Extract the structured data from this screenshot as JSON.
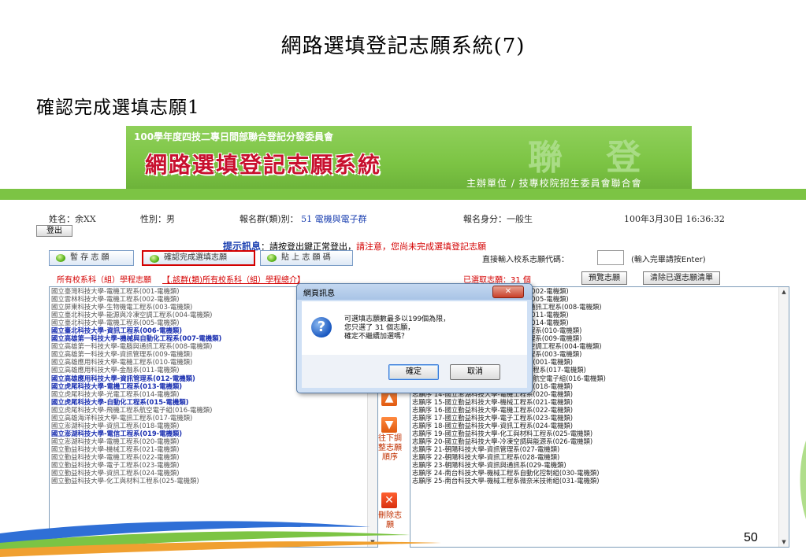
{
  "slide": {
    "title": "網路選填登記志願系統(7)",
    "subtitle": "確認完成選填志願1",
    "page_number": "50"
  },
  "banner": {
    "org": "100學年度四技二專日間部聯合登記分發委員會",
    "title": "網路選填登記志願系統",
    "host": "主辦單位 / 技專校院招生委員會聯合會",
    "watermark": "聯 登"
  },
  "user": {
    "name_label": "姓名：",
    "name_value": "余XX",
    "sex_label": "性別：",
    "sex_value": "男",
    "group_label": "報名群(類)別：",
    "group_value": "51 電機與電子群",
    "identity_label": "報名身分：",
    "identity_value": "一般生",
    "datetime": "100年3月30日 16:36:32",
    "logout_label": "登出"
  },
  "hint": {
    "label": "提示訊息",
    "text": "：請按登出鍵正常登出，",
    "warning": "請注意，您尚未完成選填登記志願"
  },
  "toolbar": {
    "save_label": "暫 存 志 願",
    "confirm_label": "確認完成選填志願",
    "paste_label": "貼 上 志 願 碼",
    "direct_label": "直接輸入校系志願代碼：",
    "direct_value": "",
    "direct_note": "(輸入完畢請按Enter)"
  },
  "list_header": {
    "all_label": "所有校系科（組）學程志願",
    "link_label": "【.該群(類)所有校系科（組）學程總介】",
    "selected_prefix": "已選取志願：",
    "selected_count": "31 個",
    "preview_label": "預覽志願",
    "clear_label": "清除已選志願清單"
  },
  "left_list": [
    {
      "text": "國立臺灣科技大學-電機工程系(001-電機類)",
      "style": ""
    },
    {
      "text": "國立雲林科技大學-電機工程系(002-電機類)",
      "style": ""
    },
    {
      "text": "國立屏東科技大學-生物機電工程系(003-電機類)",
      "style": ""
    },
    {
      "text": "國立臺北科技大學-能源與冷凍空調工程系(004-電機類)",
      "style": ""
    },
    {
      "text": "國立臺北科技大學-電機工程系(005-電機類)",
      "style": ""
    },
    {
      "text": "國立臺北科技大學-資訊工程系(006-電機類)",
      "style": "hl"
    },
    {
      "text": "國立高雄第一科技大學-機械與自動化工程系(007-電機類)",
      "style": "hl"
    },
    {
      "text": "國立高雄第一科技大學-電腦與通訊工程系(008-電機類)",
      "style": ""
    },
    {
      "text": "國立高雄第一科技大學-資訊管理系(009-電機類)",
      "style": ""
    },
    {
      "text": "國立高雄應用科技大學-電機工程系(010-電機類)",
      "style": ""
    },
    {
      "text": "國立高雄應用科技大學-金融系(011-電機類)",
      "style": ""
    },
    {
      "text": "國立高雄應用科技大學-資訊管理系(012-電機類)",
      "style": "hl"
    },
    {
      "text": "國立虎尾科技大學-電機工程系(013-電機類)",
      "style": "hl"
    },
    {
      "text": "國立虎尾科技大學-光電工程系(014-電機類)",
      "style": ""
    },
    {
      "text": "國立虎尾科技大學-自動化工程系(015-電機類)",
      "style": "hl"
    },
    {
      "text": "國立虎尾科技大學-飛機工程系航空電子組(016-電機類)",
      "style": ""
    },
    {
      "text": "國立高雄海洋科技大學-電訊工程系(017-電機類)",
      "style": ""
    },
    {
      "text": "國立澎湖科技大學-資訊工程系(018-電機類)",
      "style": ""
    },
    {
      "text": "國立澎湖科技大學-電信工程系(019-電機類)",
      "style": "hl"
    },
    {
      "text": "國立澎湖科技大學-電機工程系(020-電機類)",
      "style": ""
    },
    {
      "text": "國立勤益科技大學-機械工程系(021-電機類)",
      "style": ""
    },
    {
      "text": "國立勤益科技大學-電機工程系(022-電機類)",
      "style": ""
    },
    {
      "text": "國立勤益科技大學-電子工程系(023-電機類)",
      "style": ""
    },
    {
      "text": "國立勤益科技大學-資訊工程系(024-電機類)",
      "style": ""
    },
    {
      "text": "國立勤益科技大學-化工與材料工程系(025-電機類)",
      "style": ""
    }
  ],
  "right_list": [
    {
      "text": "志願序 1-國立臺北科技大學-電機工程系(002-電機類)",
      "visible": "-電機工程系(002-電機類)"
    },
    {
      "text": "志願序 2-國立臺北科技大學-電機工程系(005-電機類)",
      "visible": "-電機工程系(005-電機類)"
    },
    {
      "text": "志願序 3-國立高雄第一科技大學-電腦與通訊工程系(008-電機類)",
      "visible": "-電腦與通訊工程系(008-電機類)"
    },
    {
      "text": "志願序 4-國立高雄應用科技大學-金融系(011-電機類)",
      "visible": "大學-金融系(011-電機類)"
    },
    {
      "text": "志願序 5-國立虎尾科技大學-光電工程系(014-電機類)",
      "visible": "-光電工程系(014-電機類)"
    },
    {
      "text": "志願序 6-國立高雄應用科技大學-電機工程系(010-電機類)",
      "visible": "大學-電機工程系(010-電機類)"
    },
    {
      "text": "志願序 7-國立高雄第一科技大學-資訊管理系(009-電機類)",
      "visible": "大學-資訊管理系(009-電機類)"
    },
    {
      "text": "志願序 8-國立臺北科技大學-能源與冷凍空調工程系(004-電機類)",
      "visible": "-能源與冷凍空調工程系(004-電機類)"
    },
    {
      "text": "志願序 9-國立屏東科技大學-生物機電工程系(003-電機類)",
      "visible": "-生物機電工程系(003-電機類)"
    },
    {
      "text": "志願序 10-國立臺灣科技大學-電機工程系(001-電機類)",
      "visible": "-電機工程系(001-電機類)"
    },
    {
      "text": "志願序 11-國立高雄海洋科技大學-電訊工程系(017-電機類)",
      "visible": "技大學-電訊工程系(017-電機類)"
    },
    {
      "text": "志願序 12-國立虎尾科技大學-飛機工程系航空電子組(016-電機類)",
      "visible": "志願序 12-國立虎尾科技大學-飛機工程系航空電子組(016-電機類)"
    },
    {
      "text": "志願序 13-國立澎湖科技大學-資訊工程系(018-電機類)",
      "visible": "志願序 13-國立澎湖科技大學-資訊工程系(018-電機類)"
    },
    {
      "text": "志願序 14-國立澎湖科技大學-電機工程系(020-電機類)",
      "visible": "志願序 14-國立澎湖科技大學-電機工程系(020-電機類)"
    },
    {
      "text": "志願序 15-國立勤益科技大學-機械工程系(021-電機類)",
      "visible": "志願序 15-國立勤益科技大學-機械工程系(021-電機類)"
    },
    {
      "text": "志願序 16-國立勤益科技大學-電機工程系(022-電機類)",
      "visible": "志願序 16-國立勤益科技大學-電機工程系(022-電機類)"
    },
    {
      "text": "志願序 17-國立勤益科技大學-電子工程系(023-電機類)",
      "visible": "志願序 17-國立勤益科技大學-電子工程系(023-電機類)"
    },
    {
      "text": "志願序 18-國立勤益科技大學-資訊工程系(024-電機類)",
      "visible": "志願序 18-國立勤益科技大學-資訊工程系(024-電機類)"
    },
    {
      "text": "志願序 19-國立勤益科技大學-化工與材料工程系(025-電機類)",
      "visible": "志願序 19-國立勤益科技大學-化工與材料工程系(025-電機類)"
    },
    {
      "text": "志願序 20-國立勤益科技大學-冷凍空調與能源系(026-電機類)",
      "visible": "志願序 20-國立勤益科技大學-冷凍空調與能源系(026-電機類)"
    },
    {
      "text": "志願序 21-朝陽科技大學-資訊管理系(027-電機類)",
      "visible": "志願序 21-朝陽科技大學-資訊管理系(027-電機類)"
    },
    {
      "text": "志願序 22-朝陽科技大學-資訊工程系(028-電機類)",
      "visible": "志願序 22-朝陽科技大學-資訊工程系(028-電機類)"
    },
    {
      "text": "志願序 23-朝陽科技大學-資訊與通訊系(029-電機類)",
      "visible": "志願序 23-朝陽科技大學-資訊與通訊系(029-電機類)"
    },
    {
      "text": "志願序 24-南台科技大學-機械工程系自動化控制組(030-電機類)",
      "visible": "志願序 24-南台科技大學-機械工程系自動化控制組(030-電機類)"
    },
    {
      "text": "志願序 25-南台科技大學-機械工程系微奈米技術組(031-電機類)",
      "visible": "志願序 25-南台科技大學-機械工程系微奈米技術組(031-電機類)"
    }
  ],
  "mid_controls": {
    "down_label": "往下調整志願順序",
    "delete_label": "刪除志願"
  },
  "dialog": {
    "title": "網頁訊息",
    "line1": "可選填志願數最多以199個為限，",
    "line2": "您只選了 31 個志願，",
    "line3": "確定不繼續加選嗎？",
    "ok_label": "確定",
    "cancel_label": "取消"
  },
  "colors": {
    "banner_green": "#7cc444",
    "title_red": "#c8102e",
    "highlight_blue": "#1a2fb0",
    "warning_red": "#d40000"
  },
  "icons": {
    "dialog": "question-icon",
    "close": "close-icon",
    "down": "arrow-down-icon",
    "delete": "delete-x-icon",
    "toolbar": "green-dot-icon"
  }
}
